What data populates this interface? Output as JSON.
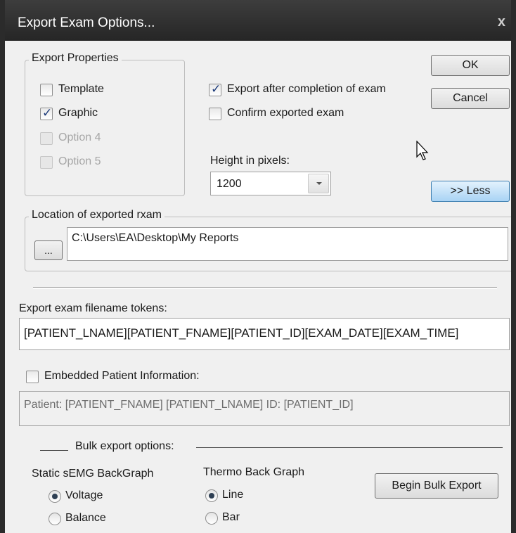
{
  "window": {
    "title": "Export Exam Options...",
    "close_glyph": "x"
  },
  "buttons": {
    "ok": "OK",
    "cancel": "Cancel",
    "less": ">> Less",
    "browse": "...",
    "begin_bulk": "Begin Bulk Export"
  },
  "export_properties": {
    "label": "Export Properties",
    "options": [
      {
        "label": "Template",
        "checked": false,
        "enabled": true
      },
      {
        "label": "Graphic",
        "checked": true,
        "enabled": true
      },
      {
        "label": "Option 4",
        "checked": false,
        "enabled": false
      },
      {
        "label": "Option 5",
        "checked": false,
        "enabled": false
      }
    ]
  },
  "export_after_completion": {
    "label": "Export after completion of exam",
    "checked": true
  },
  "confirm_exported": {
    "label": "Confirm exported exam",
    "checked": false
  },
  "height": {
    "label": "Height in pixels:",
    "value": "1200"
  },
  "location": {
    "label": "Location of exported rxam",
    "path": "C:\\Users\\EA\\Desktop\\My Reports"
  },
  "filename_tokens": {
    "label": "Export exam filename tokens:",
    "value": "[PATIENT_LNAME][PATIENT_FNAME][PATIENT_ID][EXAM_DATE][EXAM_TIME]"
  },
  "embedded_info": {
    "label": "Embedded Patient Information:",
    "checked": false,
    "value": "Patient: [PATIENT_FNAME] [PATIENT_LNAME] ID: [PATIENT_ID]"
  },
  "bulk": {
    "label": "Bulk export options:",
    "static_semg": {
      "label": "Static sEMG BackGraph",
      "options": [
        "Voltage",
        "Balance"
      ],
      "selected": "Voltage"
    },
    "thermo": {
      "label": "Thermo Back Graph",
      "options": [
        "Line",
        "Bar"
      ],
      "selected": "Line"
    }
  },
  "icons": {
    "close": "close-icon",
    "cursor": "mouse-cursor-icon",
    "dropdown": "chevron-down-icon"
  }
}
